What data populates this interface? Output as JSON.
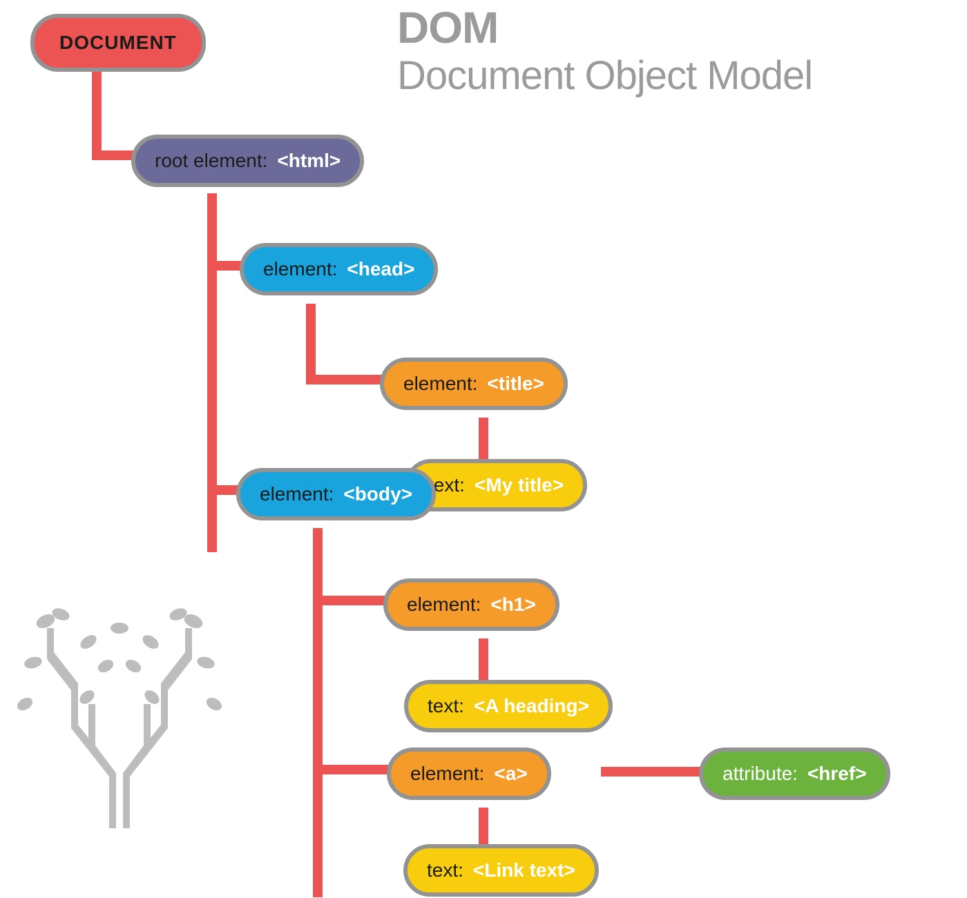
{
  "title": {
    "line1": "DOM",
    "line2": "Document Object Model"
  },
  "nodes": {
    "document": {
      "label": "DOCUMENT"
    },
    "html": {
      "label": "root element:",
      "value": "<html>"
    },
    "head": {
      "label": "element:",
      "value": "<head>"
    },
    "title_el": {
      "label": "element:",
      "value": "<title>"
    },
    "title_txt": {
      "label": "text:",
      "value": "<My title>"
    },
    "body": {
      "label": "element:",
      "value": "<body>"
    },
    "h1": {
      "label": "element:",
      "value": "<h1>"
    },
    "h1_txt": {
      "label": "text:",
      "value": "<A heading>"
    },
    "a": {
      "label": "element:",
      "value": "<a>"
    },
    "href": {
      "label": "attribute:",
      "value": "<href>"
    },
    "a_txt": {
      "label": "text:",
      "value": "<Link text>"
    }
  },
  "colors": {
    "red": "#ec5453",
    "purple": "#6b6a99",
    "blue": "#1aa4de",
    "orange": "#f49b2a",
    "yellow": "#f8cd0e",
    "green": "#6cb33e",
    "connector": "#ec5453",
    "border": "#939393",
    "titleGrey": "#9b9b9b"
  }
}
